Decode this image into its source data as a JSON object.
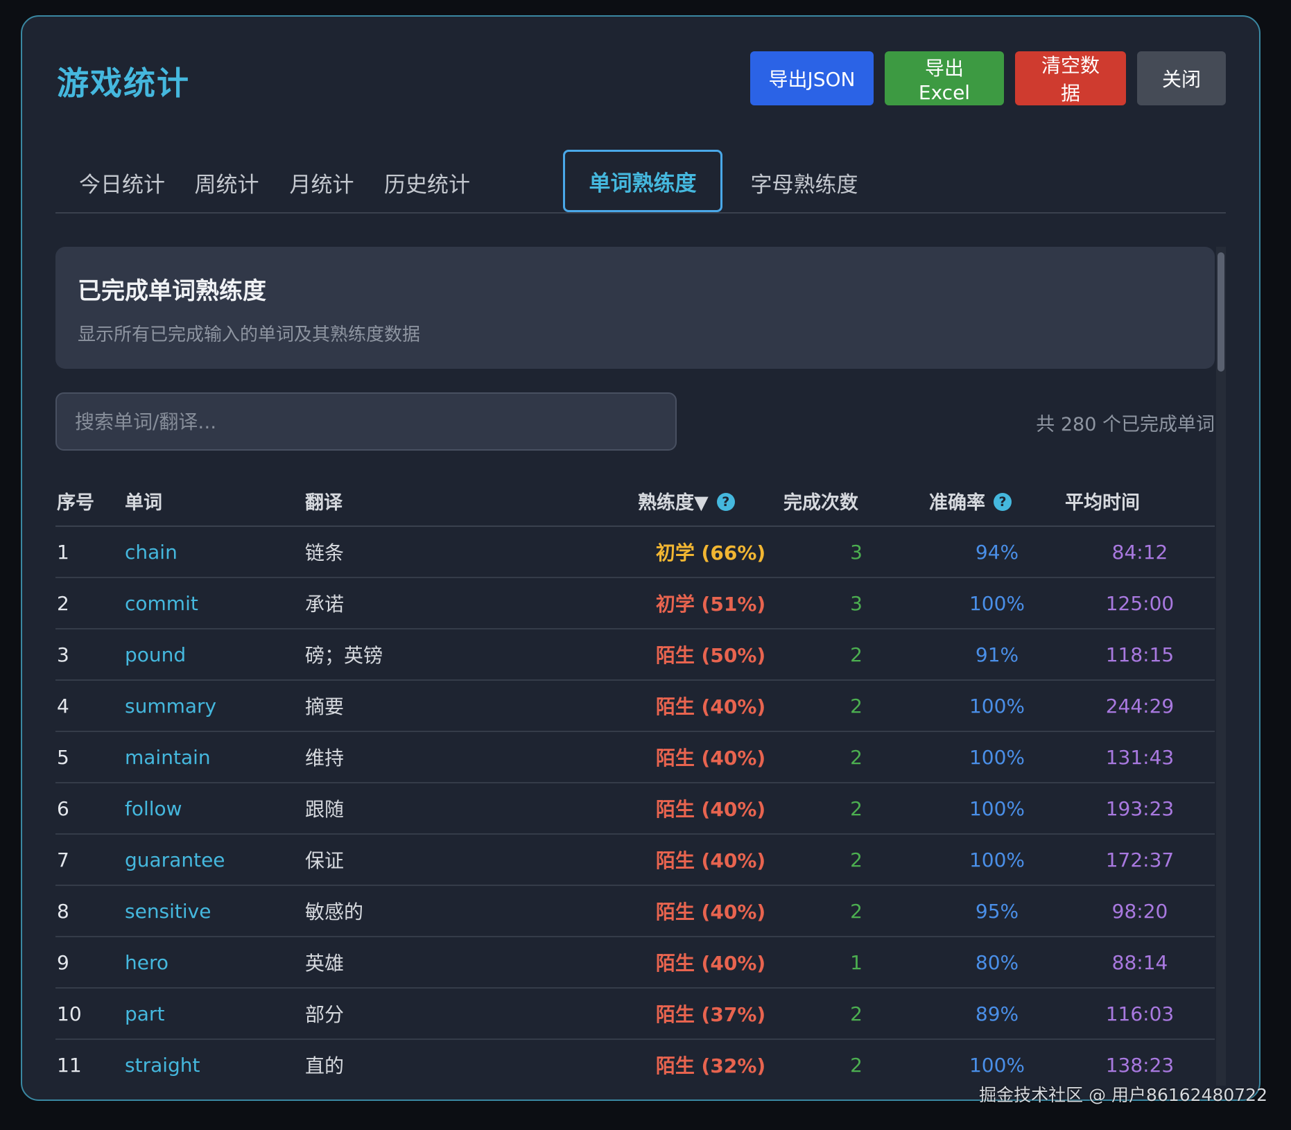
{
  "header": {
    "title": "游戏统计",
    "buttons": {
      "export_json": "导出JSON",
      "export_excel": "导出Excel",
      "clear": "清空数据",
      "close": "关闭"
    }
  },
  "tabs": [
    {
      "label": "今日统计",
      "active": false
    },
    {
      "label": "周统计",
      "active": false
    },
    {
      "label": "月统计",
      "active": false
    },
    {
      "label": "历史统计",
      "active": false
    },
    {
      "label": "单词熟练度",
      "active": true
    },
    {
      "label": "字母熟练度",
      "active": false
    }
  ],
  "section": {
    "title": "已完成单词熟练度",
    "subtitle": "显示所有已完成输入的单词及其熟练度数据"
  },
  "search": {
    "placeholder": "搜索单词/翻译..."
  },
  "count_text": "共 280 个已完成单词",
  "table": {
    "headers": {
      "index": "序号",
      "word": "单词",
      "translation": "翻译",
      "proficiency": "熟练度▼",
      "completions": "完成次数",
      "accuracy": "准确率",
      "avg_time": "平均时间"
    },
    "help_glyph": "?",
    "rows": [
      {
        "index": "1",
        "word": "chain",
        "translation": "链条",
        "proficiency": "初学 (66%)",
        "level": "beginner",
        "completions": "3",
        "accuracy": "94%",
        "avg_time": "84:12"
      },
      {
        "index": "2",
        "word": "commit",
        "translation": "承诺",
        "proficiency": "初学 (51%)",
        "level": "beginner-low",
        "completions": "3",
        "accuracy": "100%",
        "avg_time": "125:00"
      },
      {
        "index": "3",
        "word": "pound",
        "translation": "磅；英镑",
        "proficiency": "陌生 (50%)",
        "level": "unfamiliar",
        "completions": "2",
        "accuracy": "91%",
        "avg_time": "118:15"
      },
      {
        "index": "4",
        "word": "summary",
        "translation": "摘要",
        "proficiency": "陌生 (40%)",
        "level": "unfamiliar",
        "completions": "2",
        "accuracy": "100%",
        "avg_time": "244:29"
      },
      {
        "index": "5",
        "word": "maintain",
        "translation": "维持",
        "proficiency": "陌生 (40%)",
        "level": "unfamiliar",
        "completions": "2",
        "accuracy": "100%",
        "avg_time": "131:43"
      },
      {
        "index": "6",
        "word": "follow",
        "translation": "跟随",
        "proficiency": "陌生 (40%)",
        "level": "unfamiliar",
        "completions": "2",
        "accuracy": "100%",
        "avg_time": "193:23"
      },
      {
        "index": "7",
        "word": "guarantee",
        "translation": "保证",
        "proficiency": "陌生 (40%)",
        "level": "unfamiliar",
        "completions": "2",
        "accuracy": "100%",
        "avg_time": "172:37"
      },
      {
        "index": "8",
        "word": "sensitive",
        "translation": "敏感的",
        "proficiency": "陌生 (40%)",
        "level": "unfamiliar",
        "completions": "2",
        "accuracy": "95%",
        "avg_time": "98:20"
      },
      {
        "index": "9",
        "word": "hero",
        "translation": "英雄",
        "proficiency": "陌生 (40%)",
        "level": "unfamiliar",
        "completions": "1",
        "accuracy": "80%",
        "avg_time": "88:14"
      },
      {
        "index": "10",
        "word": "part",
        "translation": "部分",
        "proficiency": "陌生 (37%)",
        "level": "unfamiliar",
        "completions": "2",
        "accuracy": "89%",
        "avg_time": "116:03"
      },
      {
        "index": "11",
        "word": "straight",
        "translation": "直的",
        "proficiency": "陌生 (32%)",
        "level": "unfamiliar",
        "completions": "2",
        "accuracy": "100%",
        "avg_time": "138:23"
      }
    ]
  },
  "colors": {
    "accent": "#45b8de",
    "beginner": "#f2b632",
    "beginner-low": "#e8644f",
    "unfamiliar": "#e8644f"
  },
  "watermark": "掘金技术社区 @ 用户86162480722"
}
